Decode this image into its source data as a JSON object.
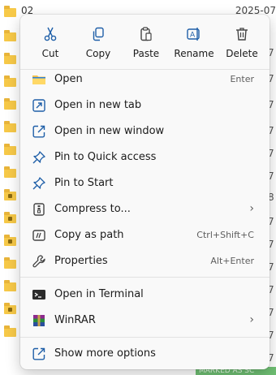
{
  "background": {
    "first_row_name": "02",
    "first_row_date": "2025-07",
    "right_column_chars": [
      "7",
      "7",
      "7",
      "7",
      "7",
      "7",
      "8",
      "7",
      "7",
      "7",
      "7",
      "7",
      "7",
      "7"
    ],
    "banner_text": "MARKED AS SC"
  },
  "quick_actions": [
    {
      "label": "Cut",
      "icon": "cut-icon"
    },
    {
      "label": "Copy",
      "icon": "copy-icon"
    },
    {
      "label": "Paste",
      "icon": "paste-icon"
    },
    {
      "label": "Rename",
      "icon": "rename-icon"
    },
    {
      "label": "Delete",
      "icon": "delete-icon"
    }
  ],
  "menu_items": [
    {
      "label": "Open",
      "shortcut": "Enter",
      "icon": "folder-open-icon"
    },
    {
      "label": "Open in new tab",
      "shortcut": "",
      "icon": "new-tab-icon"
    },
    {
      "label": "Open in new window",
      "shortcut": "",
      "icon": "new-window-icon"
    },
    {
      "label": "Pin to Quick access",
      "shortcut": "",
      "icon": "pin-icon"
    },
    {
      "label": "Pin to Start",
      "shortcut": "",
      "icon": "pin-icon"
    },
    {
      "label": "Compress to...",
      "submenu": true,
      "icon": "archive-icon"
    },
    {
      "label": "Copy as path",
      "shortcut": "Ctrl+Shift+C",
      "icon": "copy-path-icon"
    },
    {
      "label": "Properties",
      "shortcut": "Alt+Enter",
      "icon": "wrench-icon"
    },
    {
      "label": "Open in Terminal",
      "shortcut": "",
      "icon": "terminal-icon"
    },
    {
      "label": "WinRAR",
      "submenu": true,
      "icon": "winrar-icon"
    },
    {
      "label": "Show more options",
      "shortcut": "",
      "icon": "more-options-icon"
    }
  ],
  "submenu_glyph": "›",
  "colors": {
    "accent": "#0067c0",
    "menu_bg": "#f9f9f9",
    "folder": "#f7c948"
  }
}
